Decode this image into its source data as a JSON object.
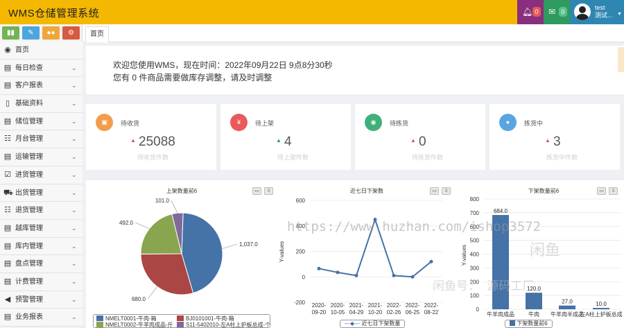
{
  "app": {
    "title": "WMS仓储管理系统"
  },
  "header": {
    "notifications_count": "0",
    "messages_count": "0",
    "user_name": "test",
    "user_subtitle": "测试..."
  },
  "sidebar": {
    "items": [
      {
        "label": "首页",
        "icon": "dashboard-icon",
        "glyph": "◉",
        "chevron": false
      },
      {
        "label": "每日检查",
        "icon": "list-icon",
        "glyph": "▤",
        "chevron": true
      },
      {
        "label": "客户报表",
        "icon": "list-icon",
        "glyph": "▤",
        "chevron": true
      },
      {
        "label": "基础资料",
        "icon": "file-icon",
        "glyph": "▯",
        "chevron": true
      },
      {
        "label": "储位管理",
        "icon": "list-icon",
        "glyph": "▤",
        "chevron": true
      },
      {
        "label": "月台管理",
        "icon": "list-icon",
        "glyph": "☷",
        "chevron": true
      },
      {
        "label": "运输管理",
        "icon": "list-icon",
        "glyph": "▤",
        "chevron": true
      },
      {
        "label": "进货管理",
        "icon": "checkbox-icon",
        "glyph": "☑",
        "chevron": true
      },
      {
        "label": "出货管理",
        "icon": "truck-icon",
        "glyph": "⛟",
        "chevron": true
      },
      {
        "label": "退货管理",
        "icon": "list-icon",
        "glyph": "☷",
        "chevron": true
      },
      {
        "label": "越库管理",
        "icon": "list-icon",
        "glyph": "▤",
        "chevron": true
      },
      {
        "label": "库内管理",
        "icon": "list-icon",
        "glyph": "▤",
        "chevron": true
      },
      {
        "label": "盘点管理",
        "icon": "list-icon",
        "glyph": "▤",
        "chevron": true
      },
      {
        "label": "计费管理",
        "icon": "list-icon",
        "glyph": "▤",
        "chevron": true
      },
      {
        "label": "预警管理",
        "icon": "volume-icon",
        "glyph": "◀",
        "chevron": true
      },
      {
        "label": "业务报表",
        "icon": "list-icon",
        "glyph": "▤",
        "chevron": true
      }
    ]
  },
  "tabs": [
    {
      "label": "首页"
    }
  ],
  "welcome": {
    "line1": "欢迎您使用WMS，现在时间：2022年09月22日 9点8分30秒",
    "line2": "您有 0 件商品需要做库存调整，请及时调整"
  },
  "stats": [
    {
      "title": "待收货",
      "value": "25088",
      "subtitle": "待收货件数",
      "color": "#f29d4a",
      "arrow_color": "#d9534f",
      "icon": "cart-icon",
      "glyph": "▣"
    },
    {
      "title": "待上架",
      "value": "4",
      "subtitle": "待上架件数",
      "color": "#ea5a5a",
      "arrow_color": "#2e9a5f",
      "icon": "yen-icon",
      "glyph": "¥"
    },
    {
      "title": "待拣货",
      "value": "0",
      "subtitle": "待拣货件数",
      "color": "#3fb07a",
      "arrow_color": "#d9534f",
      "icon": "eye-icon",
      "glyph": "◉"
    },
    {
      "title": "拣货中",
      "value": "3",
      "subtitle": "拣货中件数",
      "color": "#5aa5e0",
      "arrow_color": "#d9534f",
      "icon": "user-icon",
      "glyph": "●"
    }
  ],
  "chart_data": [
    {
      "type": "pie",
      "title": "上架数量前6",
      "categories": [
        "NMELT0001-牛肉-箱",
        "BJ0101001-牛肉-箱",
        "NMELT0002-牛羊肉成品-斤",
        "S11-5402010-左A柱上护板总成-个"
      ],
      "values": [
        1037.0,
        680.0,
        492.0,
        101.0
      ],
      "value_labels": [
        "1,037.0",
        "680.0",
        "492.0",
        "101.0"
      ],
      "colors": [
        "#4572a7",
        "#aa4643",
        "#89a54e",
        "#80699b"
      ]
    },
    {
      "type": "line",
      "title": "近七日下架数",
      "x": [
        "2020-09-20",
        "2020-10-05",
        "2021-04-29",
        "2021-10-20",
        "2022-02-26",
        "2022-06-25",
        "2022-08-22"
      ],
      "series": [
        {
          "name": "近七日下架数量",
          "values": [
            65,
            35,
            10,
            450,
            10,
            0,
            120
          ]
        }
      ],
      "ylabel": "Y-values",
      "ylim": [
        -200,
        600
      ],
      "yticks": [
        -200,
        0,
        200,
        400,
        600
      ],
      "color": "#4572a7"
    },
    {
      "type": "bar",
      "title": "下架数量前6",
      "categories": [
        "牛羊肉成品",
        "牛肉",
        "牛羊肉半成品",
        "左A柱上护板总成"
      ],
      "series": [
        {
          "name": "下架数量前6",
          "values": [
            684.0,
            120.0,
            27.0,
            10.0
          ]
        }
      ],
      "value_labels": [
        "684.0",
        "120.0",
        "27.0",
        "10.0"
      ],
      "ylabel": "Y-values",
      "ylim": [
        0,
        800
      ],
      "yticks": [
        0,
        100,
        200,
        300,
        400,
        500,
        600,
        700,
        800
      ],
      "color": "#4572a7"
    }
  ],
  "watermark": {
    "url": "https://www.huzhan.com/ishop3572",
    "logo": "闲鱼",
    "text": "闲鱼号：   源码工厂"
  }
}
